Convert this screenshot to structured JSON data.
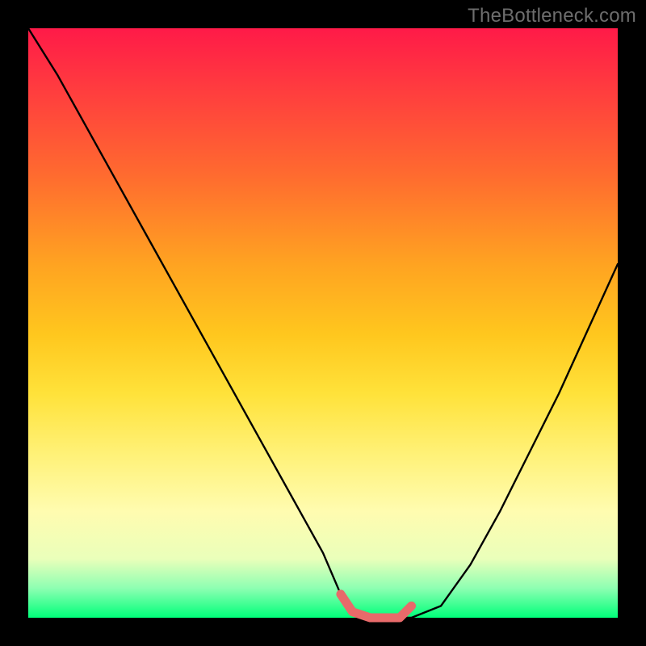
{
  "watermark": "TheBottleneck.com",
  "chart_data": {
    "type": "line",
    "title": "",
    "xlabel": "",
    "ylabel": "",
    "xlim": [
      0,
      100
    ],
    "ylim": [
      0,
      100
    ],
    "series": [
      {
        "name": "bottleneck-curve",
        "x": [
          0,
          5,
          10,
          15,
          20,
          25,
          30,
          35,
          40,
          45,
          50,
          53,
          55,
          58,
          60,
          63,
          65,
          70,
          75,
          80,
          85,
          90,
          95,
          100
        ],
        "values": [
          100,
          92,
          83,
          74,
          65,
          56,
          47,
          38,
          29,
          20,
          11,
          4,
          1,
          0,
          0,
          0,
          0,
          2,
          9,
          18,
          28,
          38,
          49,
          60
        ]
      },
      {
        "name": "highlight-band",
        "x": [
          53,
          55,
          58,
          60,
          63,
          65
        ],
        "values": [
          4,
          1,
          0,
          0,
          0,
          2
        ]
      }
    ],
    "colors": {
      "curve": "#000000",
      "highlight": "#e86a6a",
      "gradient_top": "#ff1a48",
      "gradient_bottom": "#00ff7a"
    }
  }
}
